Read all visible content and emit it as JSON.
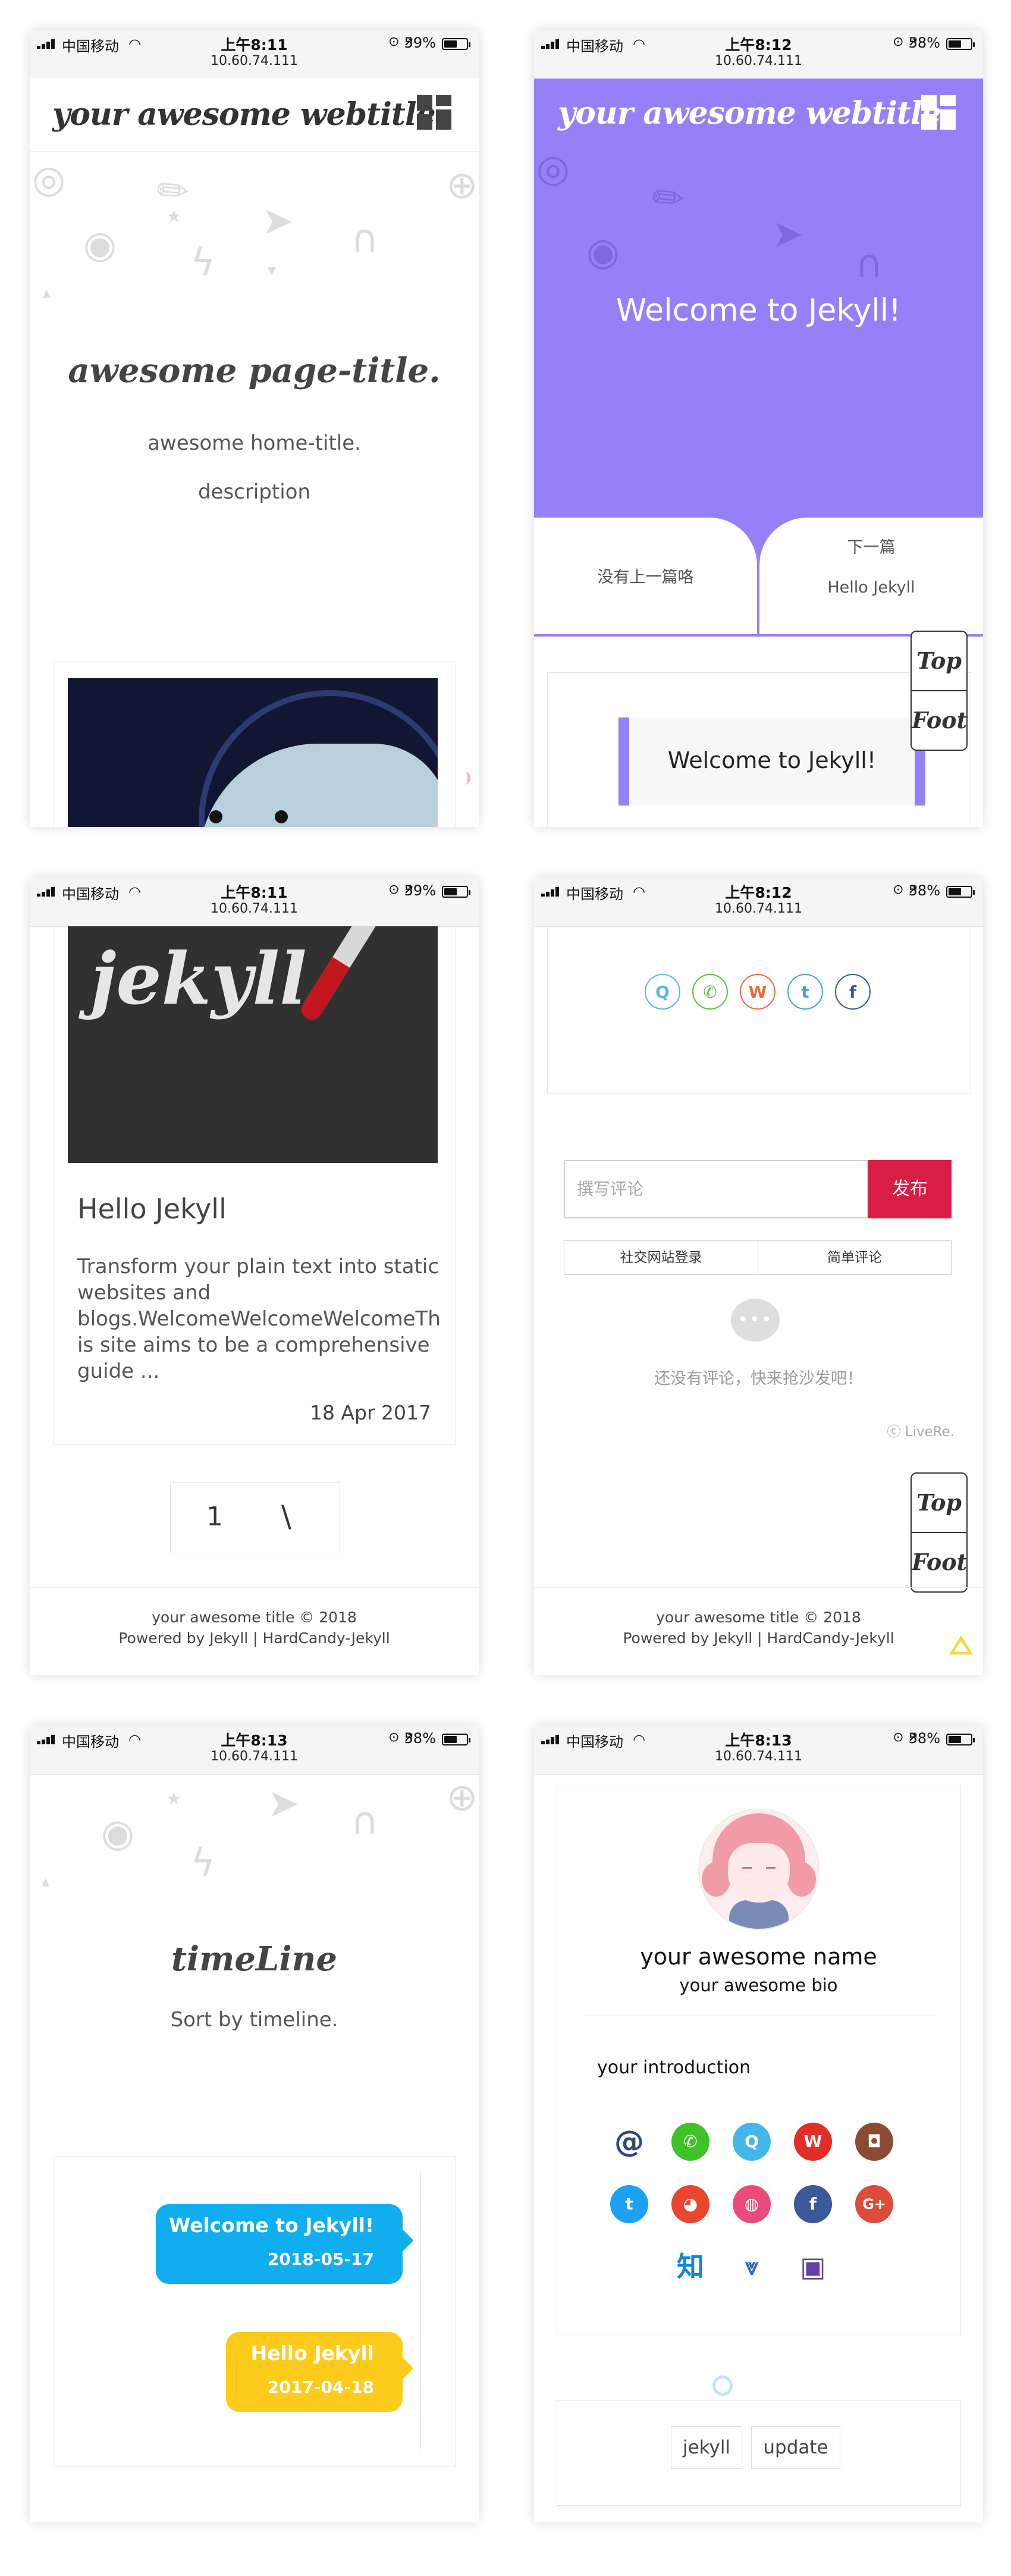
{
  "status_bar": [
    {
      "carrier": "中国移动",
      "time": "上午8:11",
      "url": "10.60.74.111",
      "battery": "59%",
      "battery_level": 0.59
    },
    {
      "carrier": "中国移动",
      "time": "上午8:12",
      "url": "10.60.74.111",
      "battery": "58%",
      "battery_level": 0.58
    },
    {
      "carrier": "中国移动",
      "time": "上午8:11",
      "url": "10.60.74.111",
      "battery": "59%",
      "battery_level": 0.59
    },
    {
      "carrier": "中国移动",
      "time": "上午8:12",
      "url": "10.60.74.111",
      "battery": "58%",
      "battery_level": 0.58
    },
    {
      "carrier": "中国移动",
      "time": "上午8:13",
      "url": "10.60.74.111",
      "battery": "58%",
      "battery_level": 0.58
    },
    {
      "carrier": "中国移动",
      "time": "上午8:13",
      "url": "10.60.74.111",
      "battery": "58%",
      "battery_level": 0.58
    }
  ],
  "site": {
    "webtitle": "your awesome webtitle"
  },
  "home": {
    "page_title": "awesome page-title.",
    "home_title": "awesome home-title.",
    "description": "description"
  },
  "post": {
    "hero_title": "Welcome to Jekyll!",
    "prev_label": "没有上一篇咯",
    "next_label": "下一篇",
    "next_title": "Hello Jekyll",
    "quote": "Welcome to Jekyll!",
    "top_button": "Top",
    "foot_button": "Foot"
  },
  "listing": {
    "image_word": "jekyll",
    "post_title": "Hello Jekyll",
    "excerpt": "Transform your plain text into static websites and blogs.WelcomeWelcomeWelcomeThis site aims to be a comprehensive guide ...",
    "date": "18 Apr 2017",
    "pager_page": "1",
    "pager_next": "\\"
  },
  "footer": {
    "line1": "your awesome title © 2018",
    "line2": "Powered by Jekyll | HardCandy-Jekyll"
  },
  "comments": {
    "share_icons": [
      "qq-icon",
      "wechat-icon",
      "weibo-icon",
      "twitter-icon",
      "facebook-icon"
    ],
    "placeholder": "撰写评论",
    "submit": "发布",
    "tab_social": "社交网站登录",
    "tab_simple": "简单评论",
    "empty_text": "还没有评论，快来抢沙发吧！",
    "brand": "ⓒ LiveRe."
  },
  "timeline": {
    "title": "timeLine",
    "subtitle": "Sort by timeline.",
    "items": [
      {
        "title": "Welcome to Jekyll!",
        "date": "2018-05-17",
        "color": "#10aeee"
      },
      {
        "title": "Hello Jekyll",
        "date": "2017-04-18",
        "color": "#fdcb1c"
      }
    ]
  },
  "about": {
    "name": "your awesome name",
    "bio": "your awesome bio",
    "introduction": "your introduction",
    "social_icons": [
      "email-icon",
      "wechat-icon",
      "qq-icon",
      "weibo-icon",
      "instagram-icon",
      "twitter-icon",
      "github-icon",
      "dribbble-icon",
      "facebook-icon",
      "google-plus-icon",
      "zhihu-icon",
      "download-icon",
      "twitch-icon"
    ],
    "zhihu_glyph": "知",
    "tags": [
      "jekyll",
      "update"
    ]
  },
  "colors": {
    "accent": "#9680f7",
    "submit_red": "#d81e45",
    "timeline_blue": "#10aeee",
    "timeline_yellow": "#fdcb1c"
  }
}
